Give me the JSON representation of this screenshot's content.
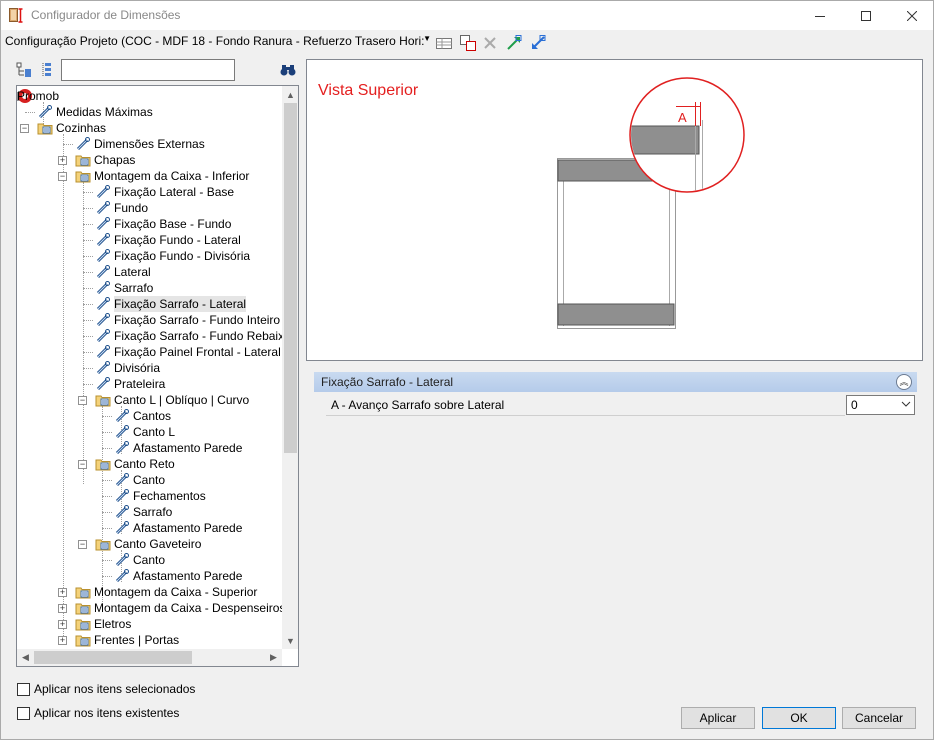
{
  "window": {
    "title": "Configurador de Dimensões",
    "colors": {
      "title_icon": "#c87533",
      "accent_red": "#e41f1f",
      "header_blue": "#b5cbea"
    }
  },
  "toolbar": {
    "config_value": "Configuração Projeto (COC - MDF 18 - Fondo Ranura - Refuerzo Trasero Hori:",
    "icons": [
      "table-edit-icon",
      "copy-icon",
      "delete-icon",
      "export-icon",
      "import-icon"
    ]
  },
  "tree": {
    "search_value": "",
    "tool_icons": [
      "expand-tree-icon",
      "collapse-tree-icon",
      "binoculars-icon"
    ],
    "nodes": {
      "promob": "Promob",
      "medidas": "Medidas Máximas",
      "cozinhas": "Cozinhas",
      "dim_ext": "Dimensões Externas",
      "chapas": "Chapas",
      "mont_inf": "Montagem da Caixa - Inferior",
      "fix_lat_base": "Fixação Lateral - Base",
      "fundo": "Fundo",
      "fix_base_fundo": "Fixação Base - Fundo",
      "fix_fundo_lat": "Fixação Fundo - Lateral",
      "fix_fundo_div": "Fixação Fundo - Divisória",
      "lateral": "Lateral",
      "sarrafo": "Sarrafo",
      "fix_sarrafo_lat": "Fixação Sarrafo - Lateral",
      "fix_sarrafo_fi": "Fixação Sarrafo - Fundo Inteiro",
      "fix_sarrafo_fr": "Fixação Sarrafo - Fundo Rebaixad",
      "fix_painel": "Fixação Painel Frontal - Lateral",
      "divisoria": "Divisória",
      "prateleira": "Prateleira",
      "canto_l": "Canto L | Oblíquo | Curvo",
      "cantos": "Cantos",
      "canto_l2": "Canto L",
      "afast1": "Afastamento Parede",
      "canto_reto": "Canto Reto",
      "canto": "Canto",
      "fechamentos": "Fechamentos",
      "sarrafo2": "Sarrafo",
      "afast2": "Afastamento Parede",
      "canto_gav": "Canto Gaveteiro",
      "canto2": "Canto",
      "afast3": "Afastamento Parede",
      "mont_sup": "Montagem da Caixa - Superior",
      "mont_desp": "Montagem da Caixa - Despenseiros | T",
      "eletros": "Eletros",
      "frentes": "Frentes | Portas"
    }
  },
  "options": {
    "apply_selected": "Aplicar nos itens selecionados",
    "apply_existing": "Aplicar nos itens existentes"
  },
  "preview": {
    "title": "Vista Superior",
    "dim_label": "A"
  },
  "properties": {
    "section_title": "Fixação Sarrafo - Lateral",
    "rows": [
      {
        "label": "A - Avanço Sarrafo sobre Lateral",
        "value": "0"
      }
    ]
  },
  "buttons": {
    "apply": "Aplicar",
    "ok": "OK",
    "cancel": "Cancelar"
  }
}
